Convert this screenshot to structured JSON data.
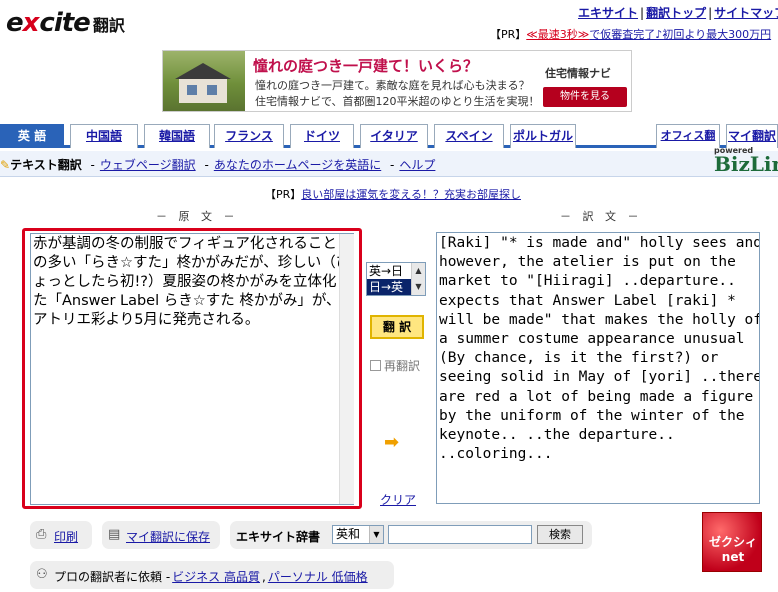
{
  "header": {
    "logo_text": "excite",
    "logo_suffix": "翻訳",
    "top_links": [
      "エキサイト",
      "翻訳トップ",
      "サイトマップ"
    ],
    "pr_prefix": "【PR】",
    "pr_red": "≪最速3秒≫",
    "pr_rest": "で仮審査完了♪初回より最大300万円"
  },
  "banner": {
    "headline": "憧れの庭つき一戸建て！いくら？",
    "line1": "憧れの庭つき一戸建て。素敵な庭を見れば心も決まる？",
    "line2": "住宅情報ナビで、首都圏120平米超のゆとり生活を実現！",
    "brand": "住宅情報ナビ",
    "button": "物件を見る"
  },
  "tabs": [
    {
      "label": "英 語",
      "active": true
    },
    {
      "label": "中国語",
      "active": false
    },
    {
      "label": "韓国語",
      "active": false
    },
    {
      "label": "フランス",
      "active": false
    },
    {
      "label": "ドイツ",
      "active": false
    },
    {
      "label": "イタリア",
      "active": false
    },
    {
      "label": "スペイン",
      "active": false
    },
    {
      "label": "ポルトガル",
      "active": false
    },
    {
      "label": "オフィス翻訳",
      "active": false
    },
    {
      "label": "マイ翻訳",
      "active": false
    }
  ],
  "subnav": {
    "current": "テキスト翻訳",
    "items": [
      "ウェブページ翻訳",
      "あなたのホームページを英語に",
      "ヘルプ"
    ],
    "powered": "powered",
    "bizlink": "BizLink"
  },
  "pr2": {
    "prefix": "【PR】",
    "link": "良い部屋は運気を変える！？充実お部屋探し"
  },
  "columns": {
    "source_label": "－ 原 文 －",
    "target_label": "－ 訳 文 －"
  },
  "source_text": "赤が基調の冬の制服でフィギュア化されることの多い「らき☆すた」柊かがみだが、珍しい（ひょっとしたら初!?）夏服姿の柊かがみを立体化した「Answer Label らき☆すた 柊かがみ」が、アトリエ彩より5月に発売される。",
  "target_text": "[Raki] \"* is made and\" holly sees and,\nhowever, the atelier is put on the\nmarket to \"[Hiiragi] ..departure..\nexpects that Answer Label [raki] *\nwill be made\" that makes the holly of\na summer costume appearance unusual\n(By chance, is it the first?) or\nseeing solid in May of [yori] ..there\nare red a lot of being made a figure\nby the uniform of the winter of the\nkeynote.. ..the departure..\n..coloring...",
  "direction": {
    "options": [
      "英→日",
      "日→英"
    ],
    "selected": "日→英"
  },
  "translate_button": "翻 訳",
  "retranslate_label": "再翻訳",
  "clear_label": "クリア",
  "bottom": {
    "print": "印刷",
    "save": "マイ翻訳に保存",
    "dict_label": "エキサイト辞書",
    "dict_option": "英和",
    "search_button": "検索",
    "pro_prefix": "プロの翻訳者に依頼 -",
    "pro_link1": "ビジネス 高品質",
    "pro_sep": ",",
    "pro_link2": "パーソナル 低価格"
  },
  "ad_square": "ゼクシィnet",
  "colors": {
    "accent_blue": "#2a63b8",
    "frame_red": "#d9001b",
    "button_yellow": "#ffe680"
  }
}
